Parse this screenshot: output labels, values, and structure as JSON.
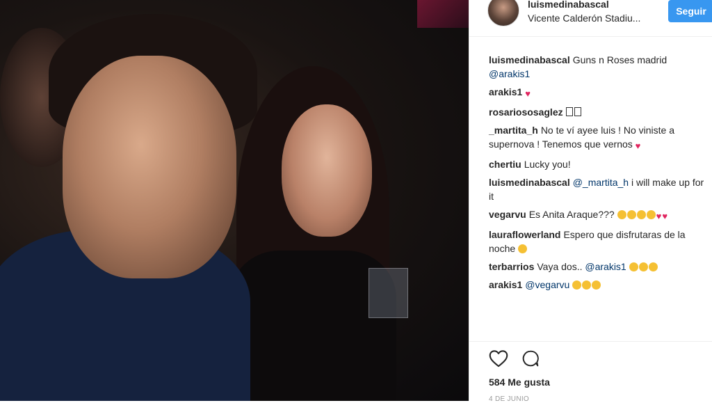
{
  "post": {
    "username": "luismedinabascal",
    "location": "Vicente Calderón Stadiu...",
    "follow_label": "Seguir",
    "likes": "584 Me gusta",
    "date": "4 DE JUNIO"
  },
  "comments": [
    {
      "user": "luismedinabascal",
      "text": "Guns n Roses madrid",
      "mention": "@arakis1",
      "emoji": []
    },
    {
      "user": "arakis1",
      "text": "",
      "mention": "",
      "emoji": [
        "heart"
      ]
    },
    {
      "user": "rosariososaglez",
      "text": "",
      "mention": "",
      "emoji": [
        "box",
        "box"
      ]
    },
    {
      "user": "_martita_h",
      "text": "No te ví ayee luis ! No viniste a supernova ! Tenemos que vernos",
      "mention": "",
      "emoji": [
        "heart"
      ]
    },
    {
      "user": "chertiu",
      "text": "Lucky you!",
      "mention": "",
      "emoji": []
    },
    {
      "user": "luismedinabascal",
      "text": "i will make up for it",
      "mention": "@_martita_h",
      "emoji": []
    },
    {
      "user": "vegarvu",
      "text": "Es Anita Araque???",
      "mention": "",
      "emoji": [
        "laugh",
        "laugh",
        "laugh",
        "laugh",
        "heart",
        "heart"
      ]
    },
    {
      "user": "lauraflowerland",
      "text": "Espero que disfrutaras de la noche",
      "mention": "",
      "emoji": [
        "laugh"
      ]
    },
    {
      "user": "terbarrios",
      "text": "Vaya dos..",
      "mention": "@arakis1",
      "emoji": [
        "laugh",
        "laugh",
        "laugh"
      ]
    },
    {
      "user": "arakis1",
      "text": "",
      "mention": "@vegarvu",
      "emoji": [
        "laugh",
        "laugh",
        "laugh"
      ]
    }
  ],
  "icons": {
    "like": "heart-outline-icon",
    "comment": "speech-bubble-icon"
  },
  "colors": {
    "accent": "#3897f0",
    "mention": "#003569",
    "heart": "#e0245e"
  }
}
